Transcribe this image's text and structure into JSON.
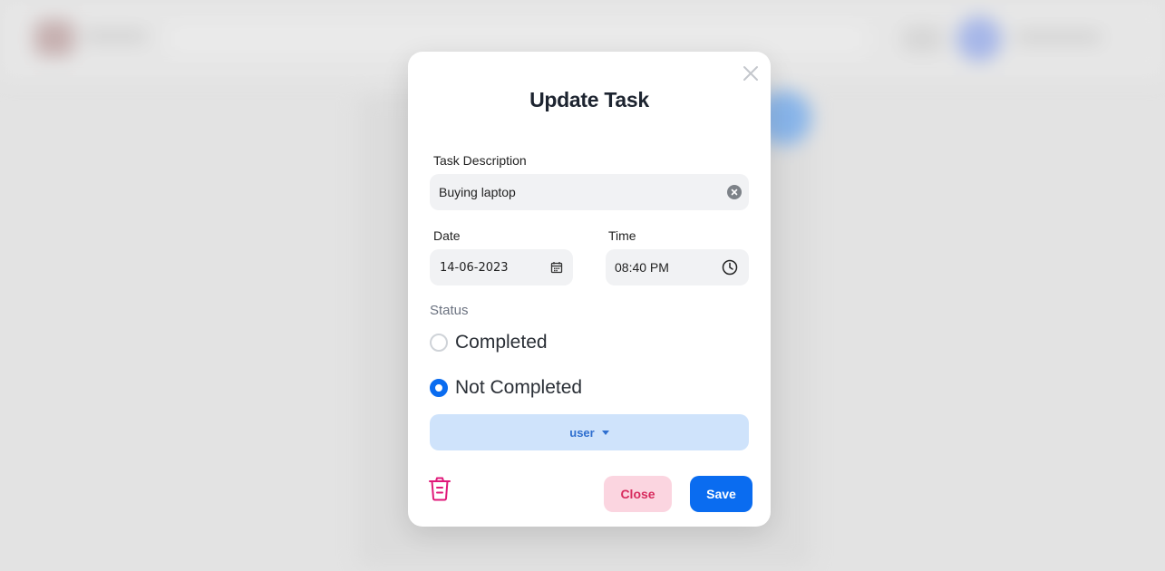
{
  "modal": {
    "title": "Update Task",
    "description_label": "Task Description",
    "description_value": "Buying laptop",
    "date_label": "Date",
    "date_value": "14-06-2023",
    "time_label": "Time",
    "time_value": "08:40 PM",
    "status_label": "Status",
    "status_options": [
      {
        "label": "Completed",
        "checked": false
      },
      {
        "label": "Not Completed",
        "checked": true
      }
    ],
    "assignee_label": "user",
    "close_label": "Close",
    "save_label": "Save"
  },
  "colors": {
    "primary": "#0a6cf0",
    "danger": "#e0197a",
    "close_bg": "#fbd5e0",
    "assignee_bg": "#cfe3fb"
  },
  "icons": [
    "close-icon",
    "clear-icon",
    "calendar-icon",
    "clock-icon",
    "chevron-down-icon",
    "trash-icon"
  ]
}
